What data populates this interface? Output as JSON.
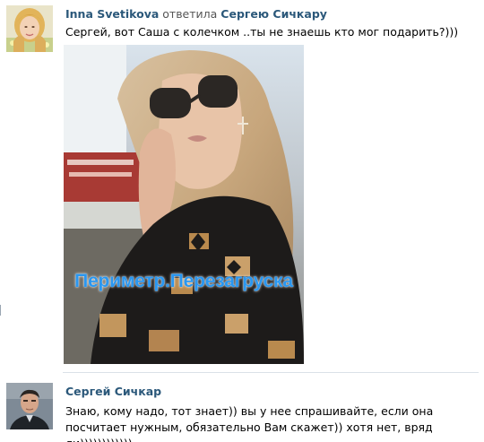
{
  "comment1": {
    "author": "Inna Svetikova",
    "action": "ответила",
    "reply_to": "Сергею Сичкару",
    "text": "Сергей, вот Саша с колечком ..ты не знаешь кто мог подарить?)))",
    "photo_watermark": "Периметр.Перезагруска"
  },
  "comment2": {
    "author": "Сергей Сичкар",
    "text": "Знаю, кому надо, тот знает)) вы у нее спрашивайте, если она посчитает нужным, обязательно Вам скажет)) хотя нет, вряд ли))))))))))))"
  },
  "colors": {
    "link": "#2b587a",
    "watermark": "#2a97f0",
    "divider": "#dae1e8"
  }
}
